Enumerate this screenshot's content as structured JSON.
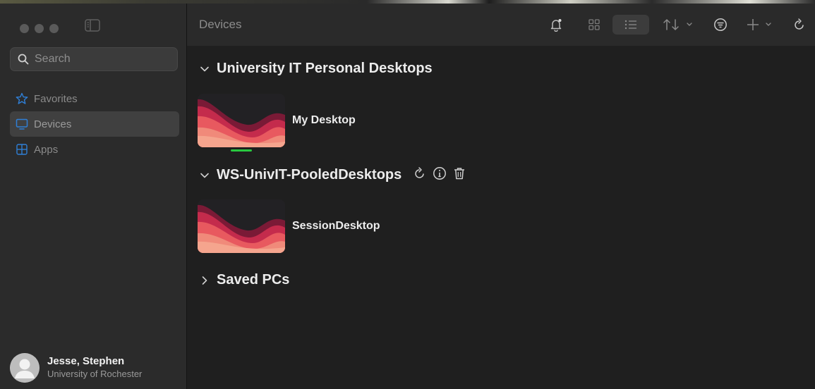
{
  "sidebar": {
    "search_placeholder": "Search",
    "items": [
      {
        "label": "Favorites",
        "icon": "star-icon",
        "active": false
      },
      {
        "label": "Devices",
        "icon": "monitor-icon",
        "active": true
      },
      {
        "label": "Apps",
        "icon": "apps-grid-icon",
        "active": false
      }
    ],
    "profile": {
      "name": "Jesse, Stephen",
      "org": "University of Rochester"
    }
  },
  "header": {
    "title": "Devices"
  },
  "toolbar": {
    "icons": [
      "bell-icon",
      "grid-view-icon",
      "list-view-icon",
      "sort-icon",
      "filter-icon",
      "add-icon",
      "refresh-icon"
    ],
    "active_view": "list"
  },
  "sections": [
    {
      "label": "University IT Personal Desktops",
      "expanded": true,
      "items": [
        {
          "name": "My Desktop",
          "connected": true
        }
      ]
    },
    {
      "label": "WS-UnivIT-PooledDesktops",
      "expanded": true,
      "actions": [
        "refresh-icon",
        "info-icon",
        "trash-icon"
      ],
      "items": [
        {
          "name": "SessionDesktop",
          "connected": false
        }
      ]
    },
    {
      "label": "Saved PCs",
      "expanded": false,
      "items": []
    }
  ],
  "colors": {
    "accent_blue": "#2f7fd6",
    "connected_green": "#28c840",
    "sidebar_bg": "#2b2b2b",
    "main_bg": "#1f1f1f"
  }
}
